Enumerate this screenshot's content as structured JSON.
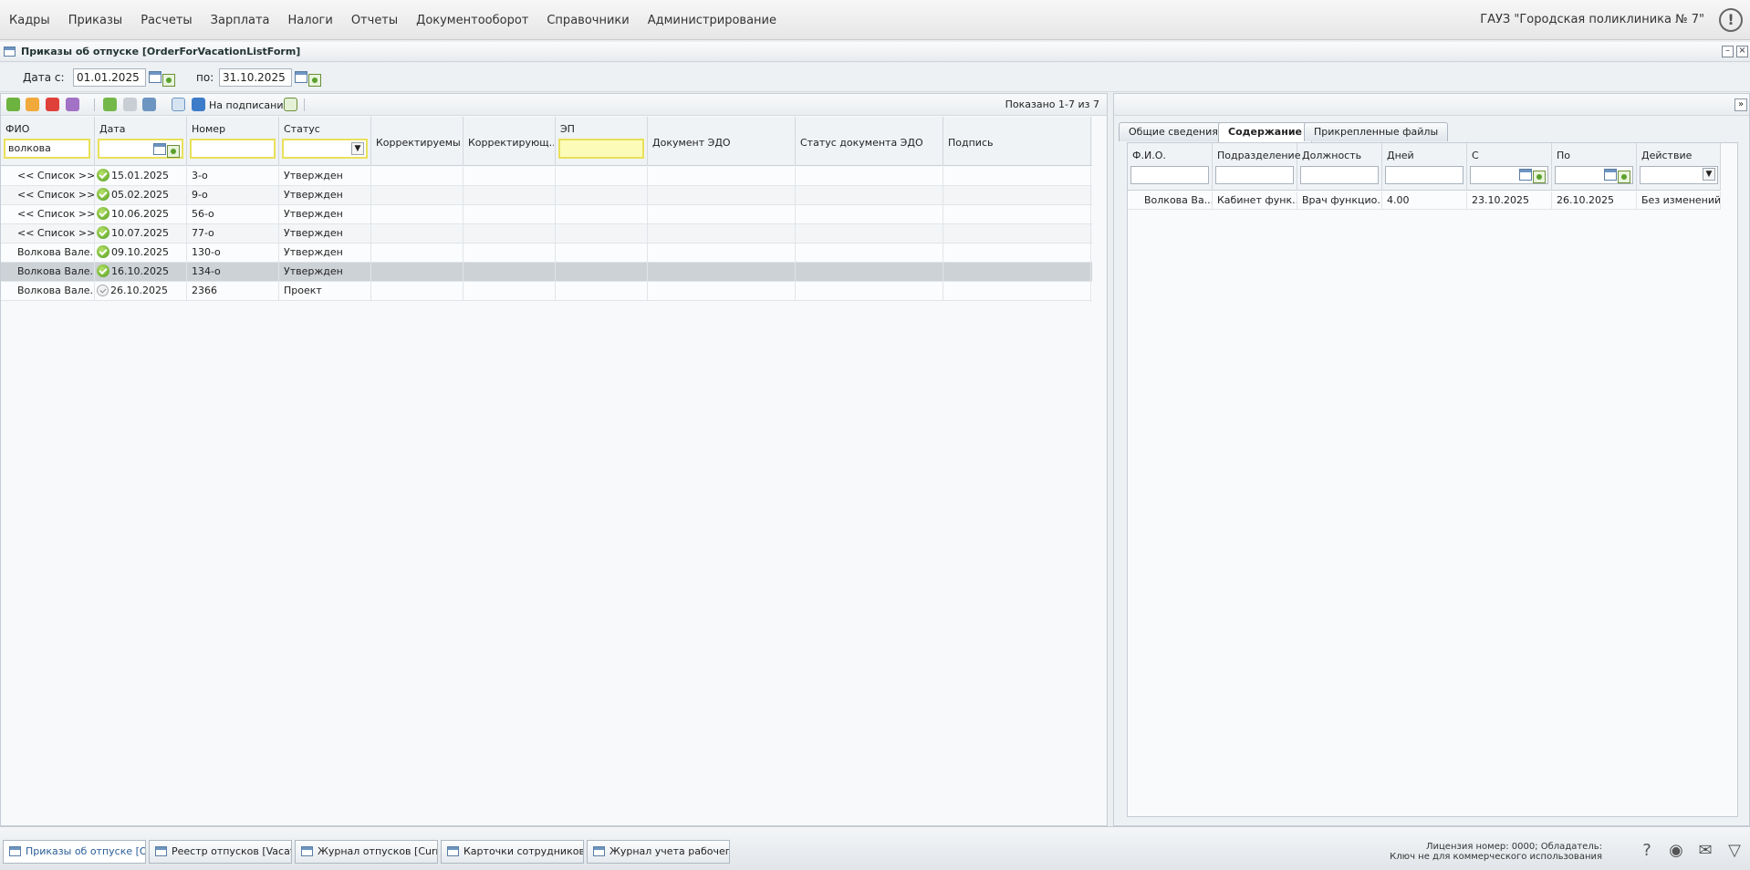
{
  "menu": {
    "items": [
      "Кадры",
      "Приказы",
      "Расчеты",
      "Зарплата",
      "Налоги",
      "Отчеты",
      "Документооборот",
      "Справочники",
      "Администрирование"
    ],
    "org": "ГАУЗ \"Городская поликлиника № 7\""
  },
  "form": {
    "title": "Приказы об отпуске [OrderForVacationListForm]"
  },
  "filters": {
    "date_from_label": "Дата с:",
    "date_from": "01.01.2025",
    "date_to_label": "по:",
    "date_to": "31.10.2025"
  },
  "toolbar": {
    "sign_label": "На подписание",
    "shown": "Показано 1-7 из 7"
  },
  "grid": {
    "columns": [
      "ФИО",
      "Дата",
      "Номер",
      "Статус",
      "Корректируемы...",
      "Корректирующ...",
      "ЭП",
      "Документ ЭДО",
      "Статус документа ЭДО",
      "Подпись"
    ],
    "fio_filter": "волкова",
    "rows": [
      {
        "fio": "<< Список >>",
        "date": "15.01.2025",
        "number": "3-о",
        "status": "Утвержден",
        "status_icon": "approved"
      },
      {
        "fio": "<< Список >>",
        "date": "05.02.2025",
        "number": "9-о",
        "status": "Утвержден",
        "status_icon": "approved"
      },
      {
        "fio": "<< Список >>",
        "date": "10.06.2025",
        "number": "56-о",
        "status": "Утвержден",
        "status_icon": "approved"
      },
      {
        "fio": "<< Список >>",
        "date": "10.07.2025",
        "number": "77-о",
        "status": "Утвержден",
        "status_icon": "approved"
      },
      {
        "fio": "Волкова Вале...",
        "date": "09.10.2025",
        "number": "130-о",
        "status": "Утвержден",
        "status_icon": "approved"
      },
      {
        "fio": "Волкова Вале...",
        "date": "16.10.2025",
        "number": "134-о",
        "status": "Утвержден",
        "status_icon": "approved"
      },
      {
        "fio": "Волкова Вале...",
        "date": "26.10.2025",
        "number": "2366",
        "status": "Проект",
        "status_icon": "draft"
      }
    ]
  },
  "details": {
    "tabs": [
      "Общие сведения",
      "Содержание",
      "Прикрепленные файлы"
    ],
    "active_tab": "Содержание",
    "columns": [
      "Ф.И.О.",
      "Подразделение",
      "Должность",
      "Дней",
      "С",
      "По",
      "Действие"
    ],
    "rows": [
      {
        "fio": "Волкова Ва...",
        "dept": "Кабинет функ...",
        "position": "Врач функцио...",
        "days": "4.00",
        "from": "23.10.2025",
        "to": "26.10.2025",
        "action": "Без изменений"
      }
    ]
  },
  "taskbar": {
    "tasks": [
      "Приказы об отпуске [Or...",
      "Реестр отпусков [Vacat...",
      "Журнал отпусков [Curr...",
      "Карточки сотрудников [...",
      "Журнал учета рабочего ..."
    ],
    "license_line1": "Лицензия номер: 0000; Обладатель:",
    "license_line2": "Ключ не для коммерческого использования"
  },
  "colors": {
    "highlight_filter": "#e9e05a",
    "selected_row": "#cdd2d7",
    "approved": "#4f9b1d"
  }
}
